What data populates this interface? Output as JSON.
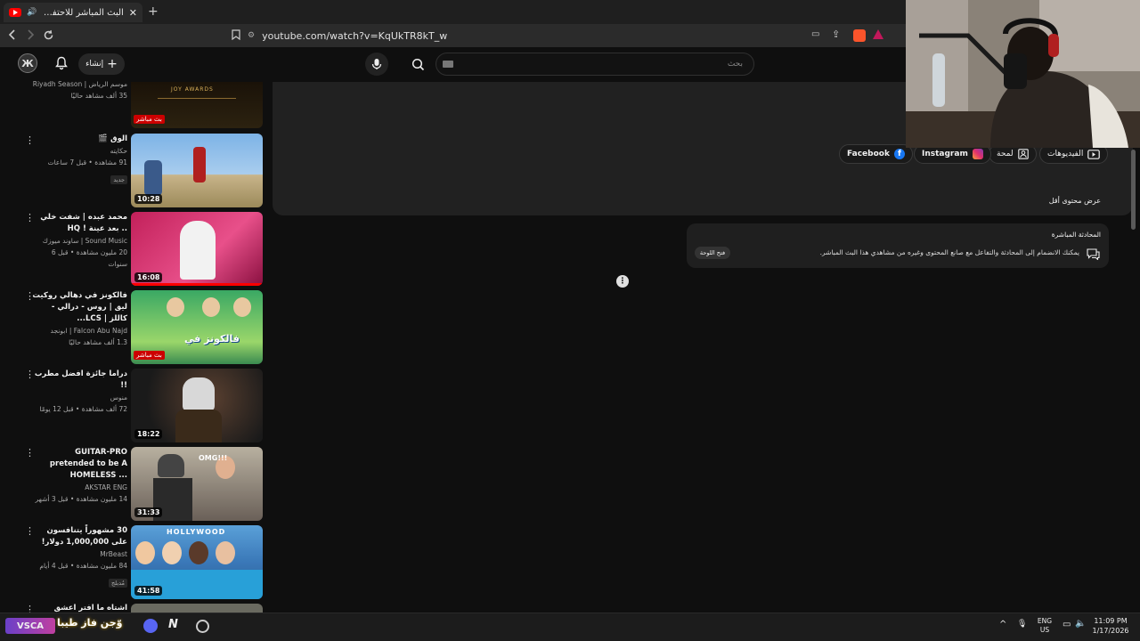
{
  "browser": {
    "tab_title": "البث المباشر للاحتفاء بأبرز نجو...",
    "url": "youtube.com/watch?v=KqUkTR8kT_w"
  },
  "masthead": {
    "search_placeholder": "بحث",
    "create_label": "إنشاء",
    "avatar_letter": "Ж"
  },
  "sidebar": {
    "videos": [
      {
        "title": "",
        "channel": "موسم الرياض | Riyadh Season",
        "stats": "35 ألف مشاهد حاليًا",
        "duration": "",
        "live_label": "بث مباشر",
        "badge": ""
      },
      {
        "title": "الوق 🎬",
        "channel": "حكايته",
        "stats": "91 مشاهدة • قبل 7 ساعات",
        "duration": "10:28",
        "live_label": "",
        "badge": "جديد"
      },
      {
        "title": "محمد عبده | شفت خلي .. بعد عينة ! HQ",
        "channel": "Sound Music | ساوند ميوزك",
        "stats": "20 مليون مشاهدة • قبل 6 سنوات",
        "duration": "16:08",
        "live_label": "",
        "badge": ""
      },
      {
        "title": "فالكونز في دهالي روكيت ليق | روس - درالي - كاللز | LCS...",
        "channel": "Falcon Abu Najd | ابونجد",
        "stats": "1.3 ألف مشاهد حاليًا",
        "duration": "",
        "live_label": "بث مباشر",
        "badge": ""
      },
      {
        "title": "دراما جائزة افضل مطرب !!",
        "channel": "منوس",
        "stats": "72 ألف مشاهدة • قبل 12 يومًا",
        "duration": "18:22",
        "live_label": "",
        "badge": ""
      },
      {
        "title": "GUITAR-PRO pretended to be A HOMELESS ...",
        "channel": "AKSTAR ENG",
        "stats": "14 مليون مشاهدة • قبل 3 أشهر",
        "duration": "31:33",
        "live_label": "",
        "badge": ""
      },
      {
        "title": "30 مشهوراً يتنافسون على 1,000,000 دولار!",
        "channel": "MrBeast",
        "stats": "84 مليون مشاهدة • قبل 4 أيام",
        "duration": "41:58",
        "live_label": "",
        "badge": "مُدبلج"
      },
      {
        "title": "اشتاه ما افتر اعشق بدونها",
        "channel": "",
        "stats": "",
        "duration": "",
        "live_label": "",
        "badge": ""
      }
    ]
  },
  "description": {
    "links": [
      "الفيديوهات",
      "لمحة",
      "Instagram",
      "Facebook"
    ],
    "show_less": "عرض محتوى أقل"
  },
  "live_chat": {
    "title": "المحادثة المباشرة",
    "text": "يمكنك الانضمام إلى المحادثة والتفاعل مع صانع المحتوى وغيره من مشاهدي هذا البث المباشر.",
    "open_label": "فتح اللوحة"
  },
  "taskbar": {
    "lang_top": "ENG",
    "lang_bottom": "US",
    "time": "11:09 PM",
    "date": "1/17/2026",
    "app_text": "وّجن فاز طيبا"
  },
  "colors": {
    "accent": "#ff0000",
    "bg": "#0f0f0f",
    "panel": "#212121"
  }
}
